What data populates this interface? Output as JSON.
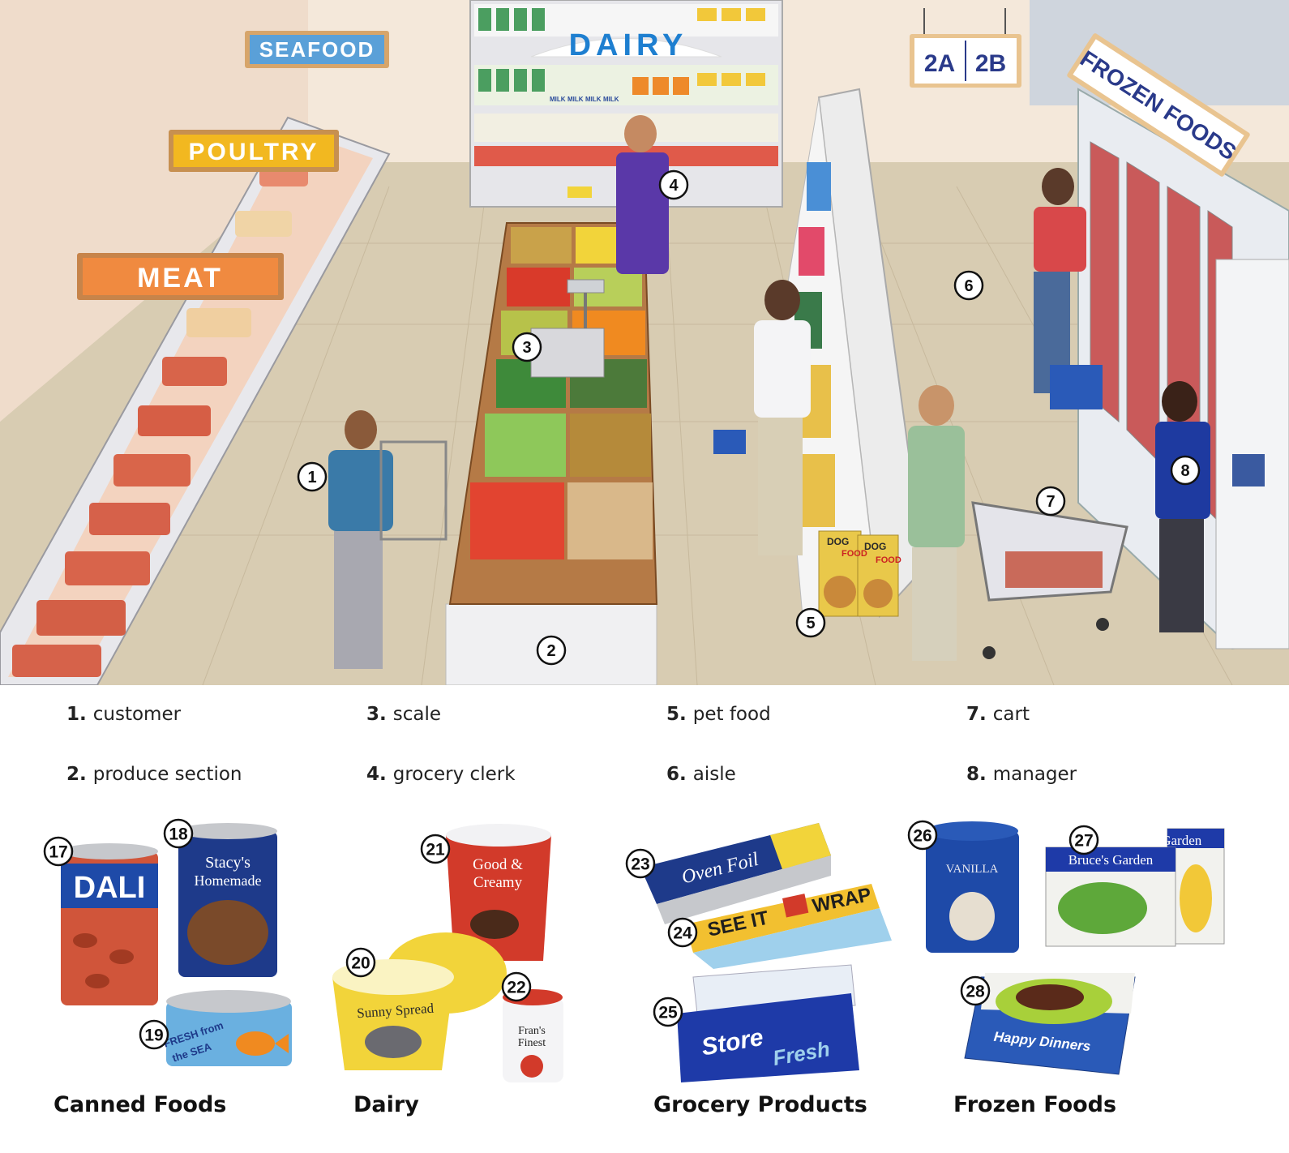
{
  "scene": {
    "signs": {
      "seafood": "SEAFOOD",
      "poultry": "POULTRY",
      "meat": "MEAT",
      "dairy": "DAIRY",
      "aisle_left": "2A",
      "aisle_right": "2B",
      "frozen_foods": "FROZEN FOODS"
    },
    "product_text": {
      "milk": "MILK",
      "dog": "DOG",
      "food": "FOOD"
    },
    "callouts": [
      "1",
      "2",
      "3",
      "4",
      "5",
      "6",
      "7",
      "8"
    ]
  },
  "vocabulary": [
    {
      "num": "1.",
      "word": "customer"
    },
    {
      "num": "2.",
      "word": "produce section"
    },
    {
      "num": "3.",
      "word": "scale"
    },
    {
      "num": "4.",
      "word": "grocery clerk"
    },
    {
      "num": "5.",
      "word": "pet food"
    },
    {
      "num": "6.",
      "word": "aisle"
    },
    {
      "num": "7.",
      "word": "cart"
    },
    {
      "num": "8.",
      "word": "manager"
    }
  ],
  "categories": [
    {
      "title": "Canned Foods",
      "numbers": [
        "17",
        "18",
        "19"
      ]
    },
    {
      "title": "Dairy",
      "numbers": [
        "20",
        "21",
        "22"
      ]
    },
    {
      "title": "Grocery Products",
      "numbers": [
        "23",
        "24",
        "25"
      ]
    },
    {
      "title": "Frozen Foods",
      "numbers": [
        "26",
        "27",
        "28"
      ]
    }
  ],
  "product_labels": {
    "dali": "DALI",
    "stacys_1": "Stacy's",
    "stacys_2": "Homemade",
    "fresh_1": "FRESH from",
    "fresh_2": "the SEA",
    "sunny_spread": "Sunny Spread",
    "good_creamy_1": "Good &",
    "good_creamy_2": "Creamy",
    "frans_1": "Fran's",
    "frans_2": "Finest",
    "oven_foil": "Oven Foil",
    "see_it": "SEE IT",
    "wrap": "WRAP",
    "store": "Store",
    "fresh": "Fresh",
    "vanilla": "VANILLA",
    "bruces_garden": "Bruce's Garden",
    "happy_dinners": "Happy Dinners"
  },
  "colors": {
    "sign_blue": "#5aa0d8",
    "sign_yellow": "#f2b820",
    "sign_orange": "#f08a40",
    "dairy_blue": "#1e7fd0",
    "frozen_text": "#2a3a8a",
    "floor": "#d9cdb3",
    "wall": "#f3e6d8"
  }
}
